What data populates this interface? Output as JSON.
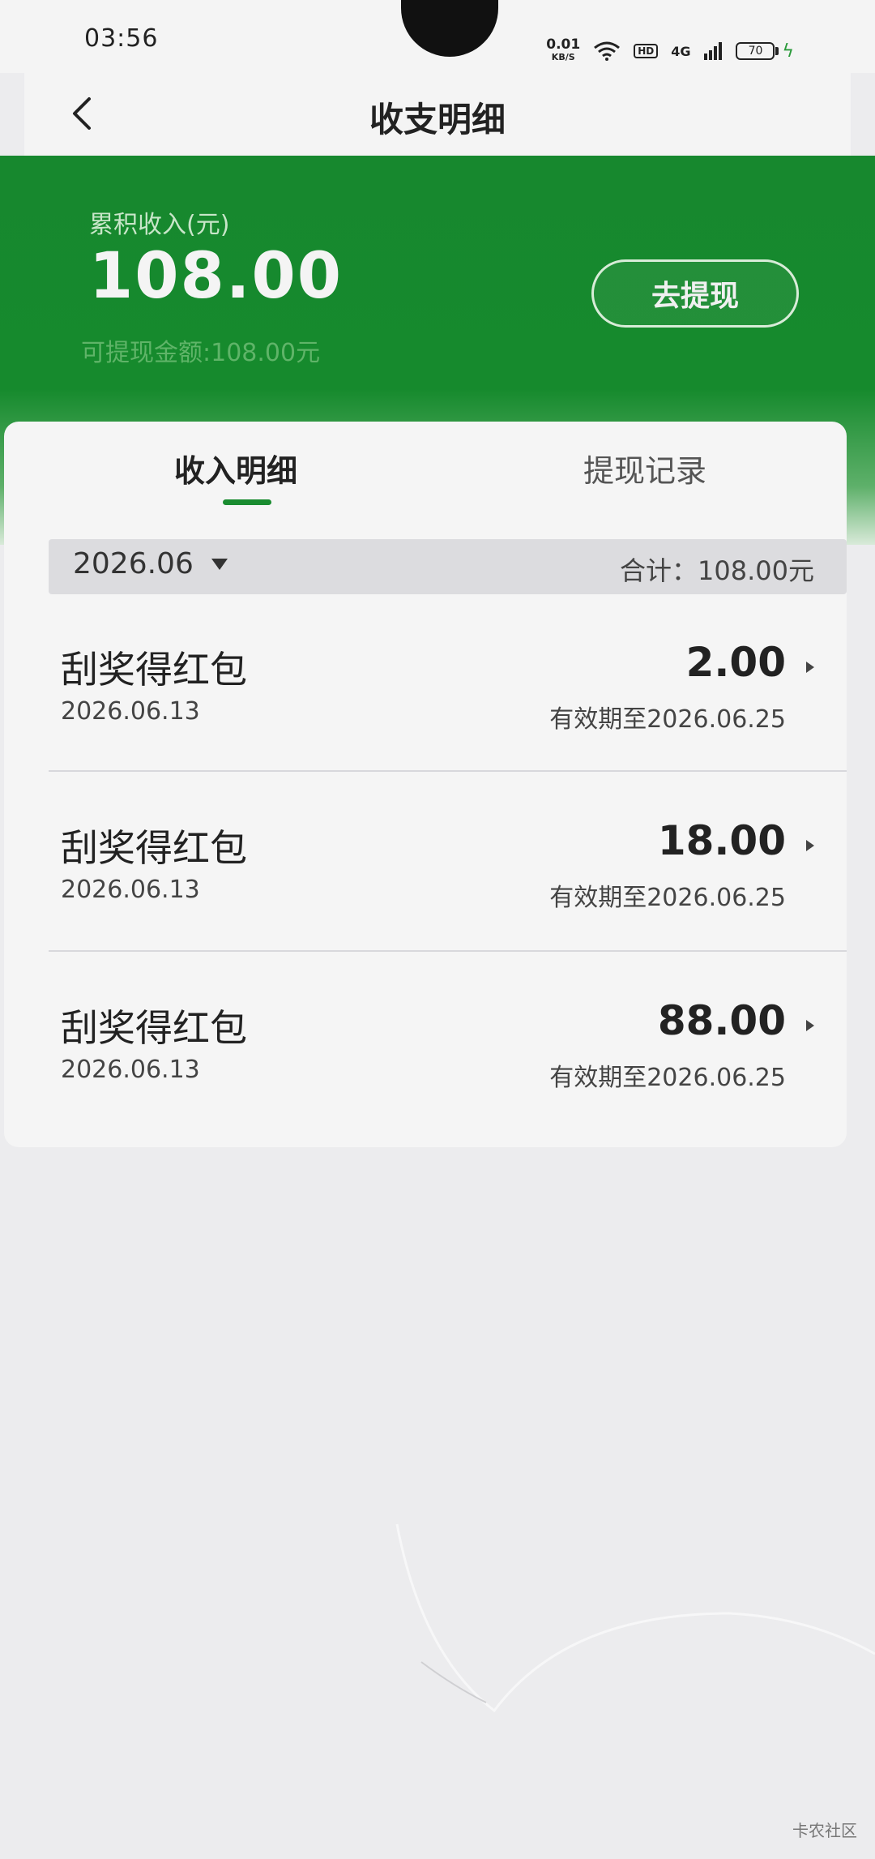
{
  "status_bar": {
    "time": "03:56",
    "net_speed": "0.01",
    "net_unit": "KB/S",
    "hd": "HD",
    "signal": "4G",
    "battery": "70"
  },
  "header": {
    "title": "收支明细"
  },
  "summary": {
    "income_label": "累积收入(元)",
    "income_amount": "108.00",
    "withdrawable": "可提现金额:108.00元",
    "withdraw_button": "去提现"
  },
  "tabs": [
    {
      "label": "收入明细",
      "active": true
    },
    {
      "label": "提现记录",
      "active": false
    }
  ],
  "filter": {
    "month": "2026.06",
    "total": "合计：108.00元"
  },
  "records": [
    {
      "title": "刮奖得红包",
      "date": "2026.06.13",
      "amount": "2.00",
      "expiry": "有效期至2026.06.25"
    },
    {
      "title": "刮奖得红包",
      "date": "2026.06.13",
      "amount": "18.00",
      "expiry": "有效期至2026.06.25"
    },
    {
      "title": "刮奖得红包",
      "date": "2026.06.13",
      "amount": "88.00",
      "expiry": "有效期至2026.06.25"
    }
  ],
  "watermark": "卡农社区",
  "colors": {
    "brand_green": "#17882e",
    "indicator_green": "#1a8c30"
  }
}
